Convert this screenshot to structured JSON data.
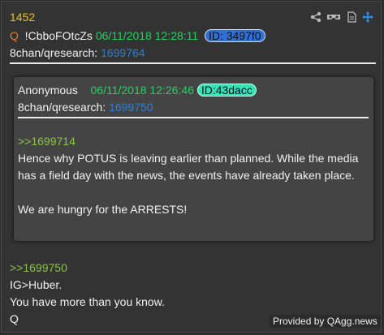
{
  "post_number": "1452",
  "author": {
    "q_mark": "Q",
    "tripcode": "!CbboFOtcZs",
    "date": "06/11/2018 12:28:11",
    "id": "ID: 3497f0"
  },
  "source": {
    "board": "8chan/qresearch:",
    "post_ref": "1699764"
  },
  "icons": [
    "share-icon",
    "vr-glasses-icon",
    "document-icon",
    "move-icon"
  ],
  "quoted_post": {
    "author": "Anonymous",
    "date": "06/11/2018 12:26:46",
    "id": "ID:43dacc",
    "board": "8chan/qresearch:",
    "post_ref": "1699750",
    "quote_link": ">>1699714",
    "body_line1": "Hence why POTUS is leaving earlier than planned. While the media",
    "body_line2": "has a field day with the news, the events have already taken place.",
    "body_line3": "We are hungry for the ARRESTS!"
  },
  "reply": {
    "quote_link": ">>1699750",
    "line1": "IG>Huber.",
    "line2": "You have more than you know.",
    "line3": "Q"
  },
  "footer": {
    "provided_by": "Provided by QAgg.news"
  },
  "colors": {
    "post_number": "#f2c200",
    "q_mark": "#e07a2e",
    "date": "#23d160",
    "link": "#2e7fd6",
    "quote_link": "#8bc34a",
    "id_blue": "#2e6fd8",
    "id_green": "#36e3b5"
  }
}
